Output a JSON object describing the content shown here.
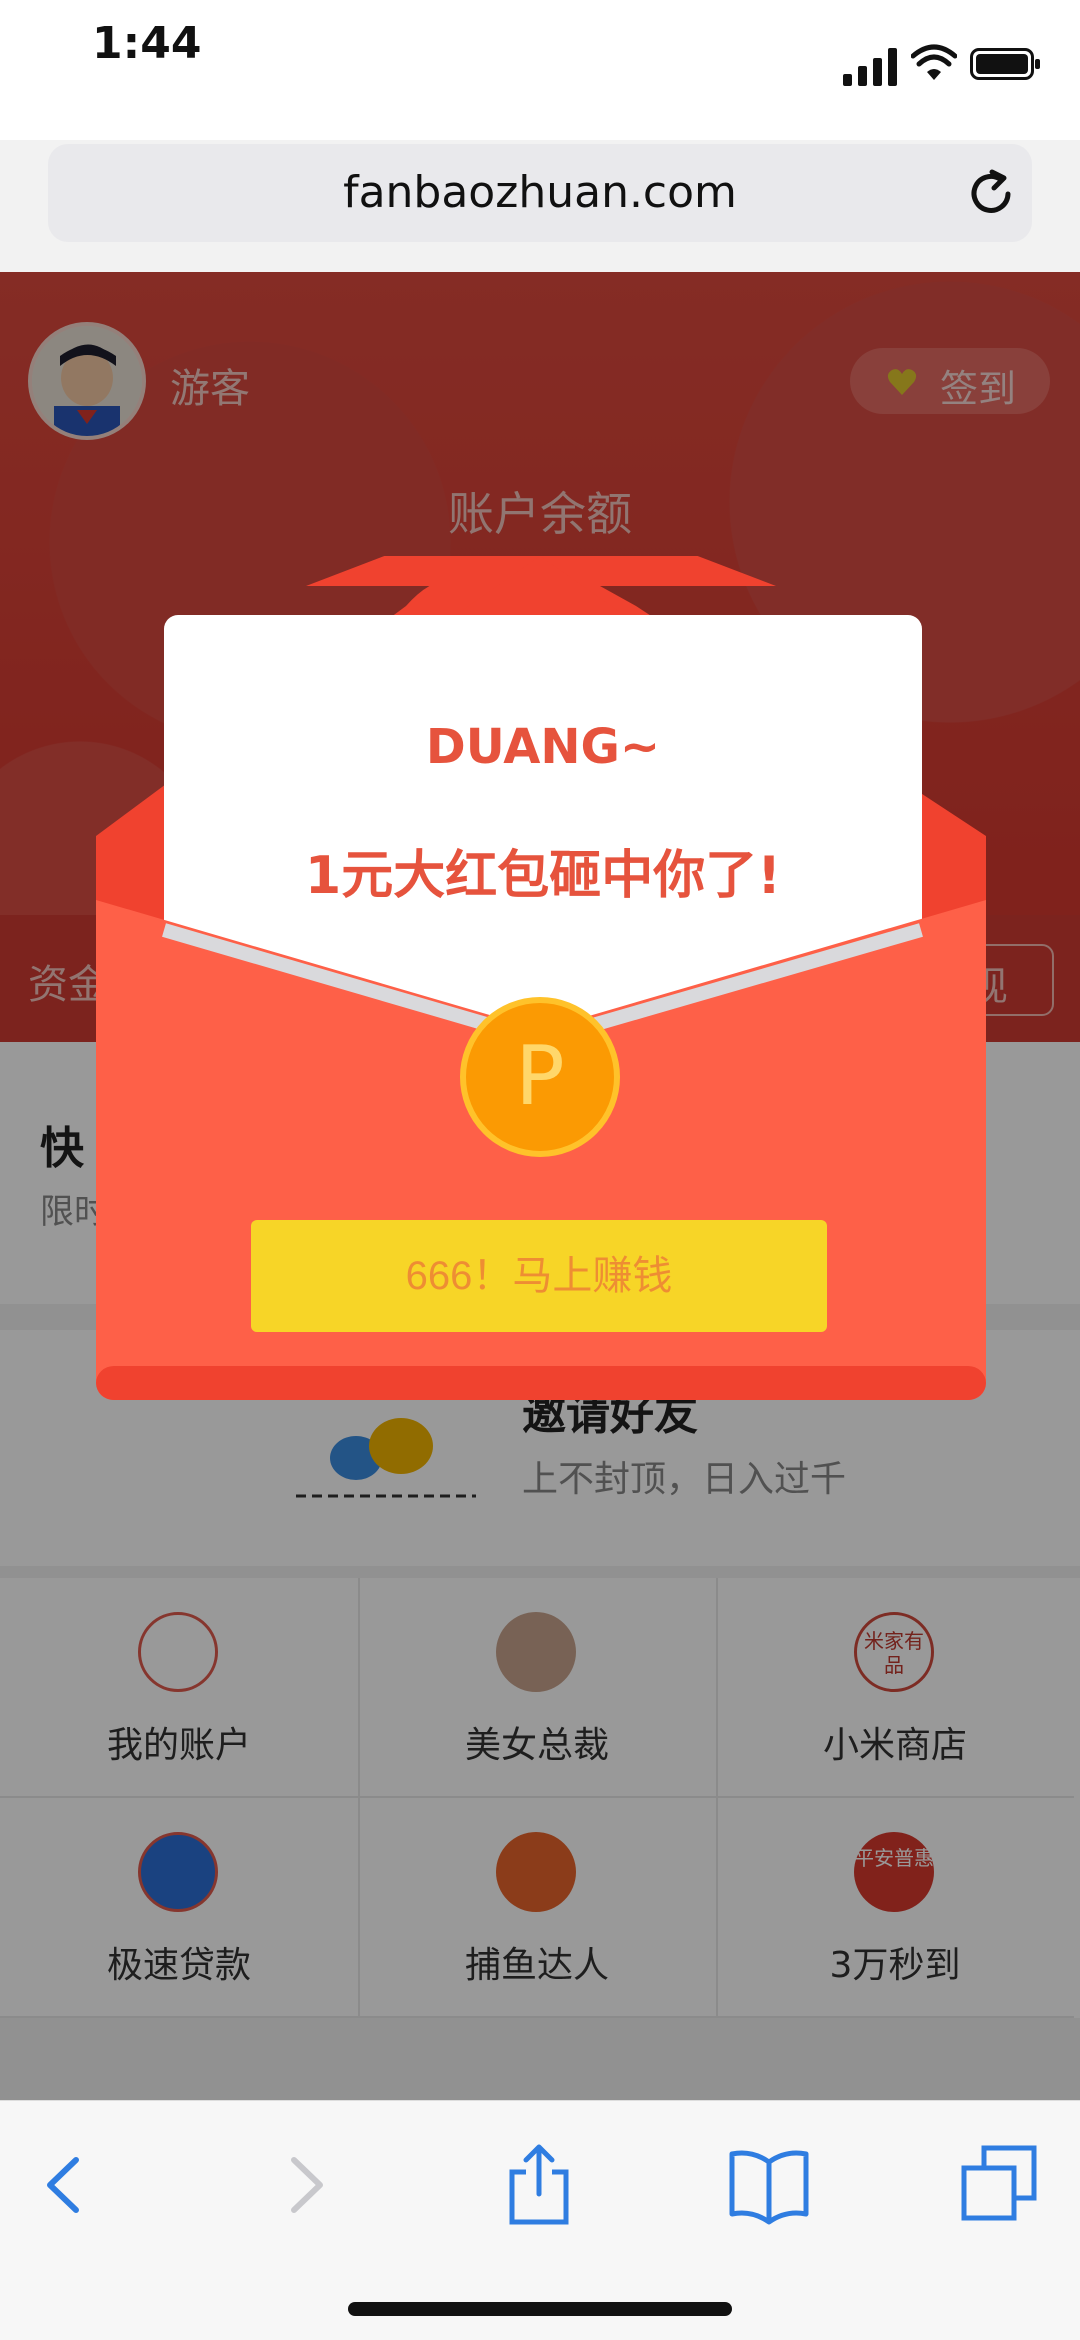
{
  "status_bar": {
    "time": "1:44"
  },
  "browser": {
    "url": "fanbaozhuan.com"
  },
  "page": {
    "user": {
      "name": "游客",
      "checkin_label": "签到"
    },
    "balance": {
      "title": "账户余额"
    },
    "hero_bar": {
      "left_text": "资金",
      "right_text": "现"
    },
    "quick": {
      "title": "快",
      "subtitle": "限时"
    },
    "invite": {
      "title": "邀请好友",
      "subtitle": "上不封顶，日入过千"
    },
    "grid": [
      {
        "label": "我的账户",
        "icon": "user-circle-icon"
      },
      {
        "label": "美女总裁",
        "icon": "woman-avatar-icon"
      },
      {
        "label": "小米商店",
        "icon": "mijia-logo-icon",
        "icon_text": "米家有品"
      },
      {
        "label": "极速贷款",
        "icon": "blue-swirl-icon"
      },
      {
        "label": "捕鱼达人",
        "icon": "fish-game-icon"
      },
      {
        "label": "3万秒到",
        "icon": "pingan-logo-icon",
        "icon_text": "平安普惠"
      }
    ]
  },
  "popup": {
    "headline": "DUANG~",
    "message": "1元大红包砸中你了!",
    "coin_letter": "P",
    "button_label": "666！马上赚钱"
  },
  "toolbar": {
    "icons": [
      "back-icon",
      "forward-icon",
      "share-icon",
      "bookmarks-icon",
      "tabs-icon"
    ]
  }
}
